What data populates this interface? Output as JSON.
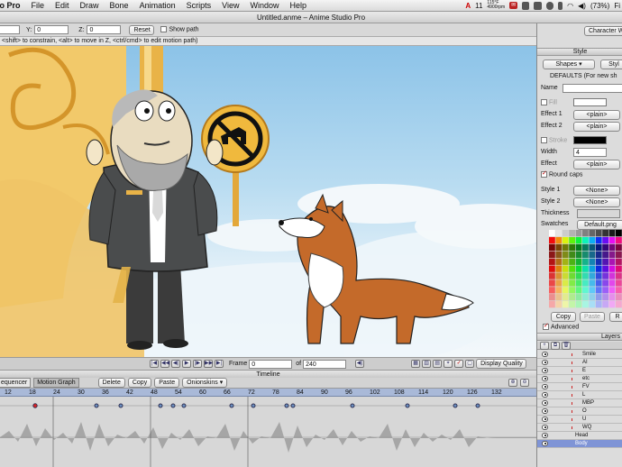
{
  "menubar": {
    "app": "udio Pro",
    "items": [
      "File",
      "Edit",
      "Draw",
      "Bone",
      "Animation",
      "Scripts",
      "View",
      "Window",
      "Help"
    ],
    "status": {
      "notifications": "11",
      "temp_top": "115°F",
      "temp_bottom": "4900rpm",
      "battery": "(73%)",
      "user": "Fi"
    }
  },
  "window": {
    "title": "Untitled.anme – Anime Studio Pro"
  },
  "toolopts": {
    "y_label": "Y:",
    "y_value": "0",
    "z_label": "Z:",
    "z_value": "0",
    "reset": "Reset",
    "show_path": "Show path",
    "hint": "<shift> to constrain, <alt> to move in Z, <ctrl/cmd> to edit motion path)"
  },
  "canvas": {
    "sign_icon": "no-dogs-sign-icon",
    "character": "old-man-character",
    "dog": "collie-dog-character"
  },
  "playback": {
    "frame_label": "Frame",
    "frame_value": "0",
    "of_label": "of",
    "total_frames": "240",
    "quality": "Display Quality"
  },
  "timeline": {
    "title": "Timeline",
    "tabs": [
      "equencer",
      "Motion Graph"
    ],
    "buttons": [
      "Delete",
      "Copy",
      "Paste"
    ],
    "onionskins": "Onionskins",
    "ruler": [
      "12",
      "18",
      "24",
      "30",
      "36",
      "42",
      "48",
      "54",
      "60",
      "66",
      "72",
      "78",
      "84",
      "90",
      "96",
      "102",
      "108",
      "114",
      "120",
      "126",
      "132"
    ]
  },
  "panel": {
    "top_button": "Character W",
    "style_title": "Style",
    "shapes_btn": "Shapes",
    "style_btn": "Styl",
    "defaults": "DEFAULTS (For new sh",
    "name_label": "Name",
    "fill_label": "Fill",
    "effect1_label": "Effect 1",
    "effect1_value": "<plain>",
    "effect2_label": "Effect 2",
    "effect2_value": "<plain>",
    "stroke_label": "Stroke",
    "width_label": "Width",
    "width_value": "4",
    "effect_label": "Effect",
    "effect_value": "<plain>",
    "round_caps": "Round caps",
    "style1_label": "Style 1",
    "style1_value": "<None>",
    "style2_label": "Style 2",
    "style2_value": "<None>",
    "thickness_label": "Thickness",
    "swatches_label": "Swatches",
    "swatches_value": "Default.png",
    "copy": "Copy",
    "paste": "Paste",
    "reset_short": "R",
    "advanced": "Advanced",
    "layers_title": "Layers",
    "layers": [
      {
        "name": "Smile"
      },
      {
        "name": "AI"
      },
      {
        "name": "E"
      },
      {
        "name": "etc"
      },
      {
        "name": "FV"
      },
      {
        "name": "L"
      },
      {
        "name": "MBP"
      },
      {
        "name": "O"
      },
      {
        "name": "U"
      },
      {
        "name": "WQ"
      },
      {
        "name": "Head"
      },
      {
        "name": "Body"
      }
    ]
  },
  "colors": {
    "accent": "#7f94d6",
    "sky": "#9ecbea",
    "gold": "#e9b347"
  }
}
